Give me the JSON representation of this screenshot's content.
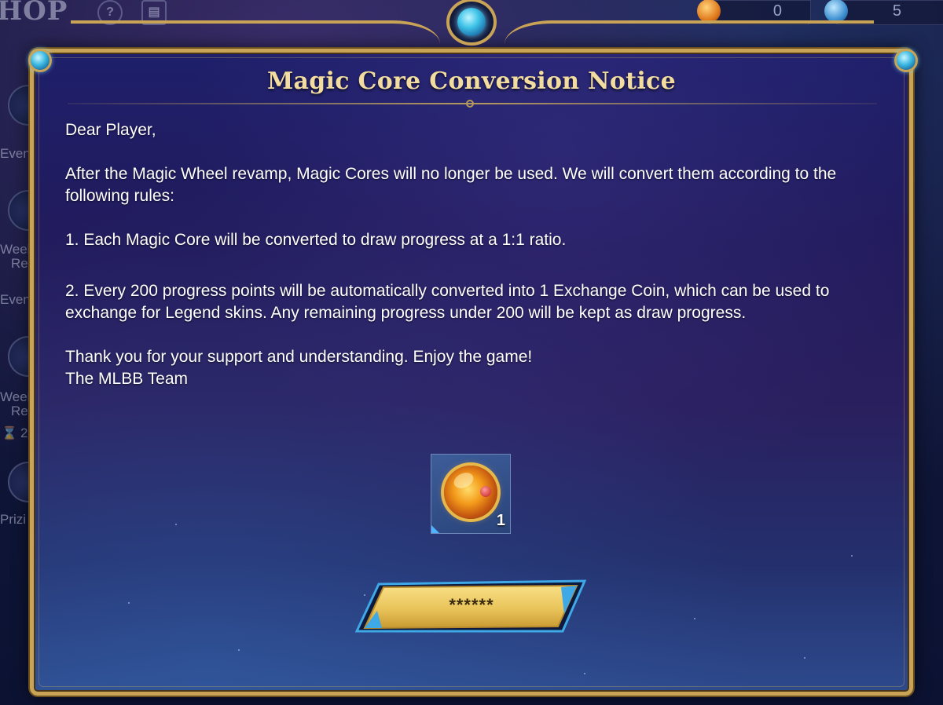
{
  "background": {
    "shop_title": "HOP",
    "top_icons": [
      {
        "name": "help-icon",
        "glyph": "?"
      },
      {
        "name": "record-icon",
        "glyph": "▤"
      }
    ],
    "currencies": [
      {
        "icon": "magic-core-icon",
        "amount": "0",
        "color": "#e07a1c"
      },
      {
        "icon": "crystal-icon",
        "amount": "5",
        "color": "#3c8fd0"
      }
    ],
    "side_labels": [
      "Even",
      "Week",
      "Rew",
      "Even",
      "Week",
      "Rew",
      "2",
      "Prizi"
    ]
  },
  "notice": {
    "title": "Magic Core Conversion Notice",
    "greeting": "Dear Player,",
    "paragraph_intro": "After the Magic Wheel revamp, Magic Cores will no longer be used. We will convert them according to the following rules:",
    "rule_1": "1. Each Magic Core will be converted to draw progress at a 1:1 ratio.",
    "rule_2": "2. Every 200 progress points will be automatically converted into 1 Exchange Coin, which can be used to exchange for Legend skins. Any remaining progress under 200 will be kept as draw progress.",
    "closing": "Thank you for your support and understanding. Enjoy the game!",
    "signature": "The MLBB Team",
    "reward": {
      "icon": "magic-core-icon",
      "count": "1"
    },
    "confirm_button_label": "******"
  },
  "colors": {
    "frame_gold": "#c9a356",
    "title_text": "#f3dca0",
    "button_gold": "#e9c45a",
    "button_accent": "#3fa9e8"
  }
}
